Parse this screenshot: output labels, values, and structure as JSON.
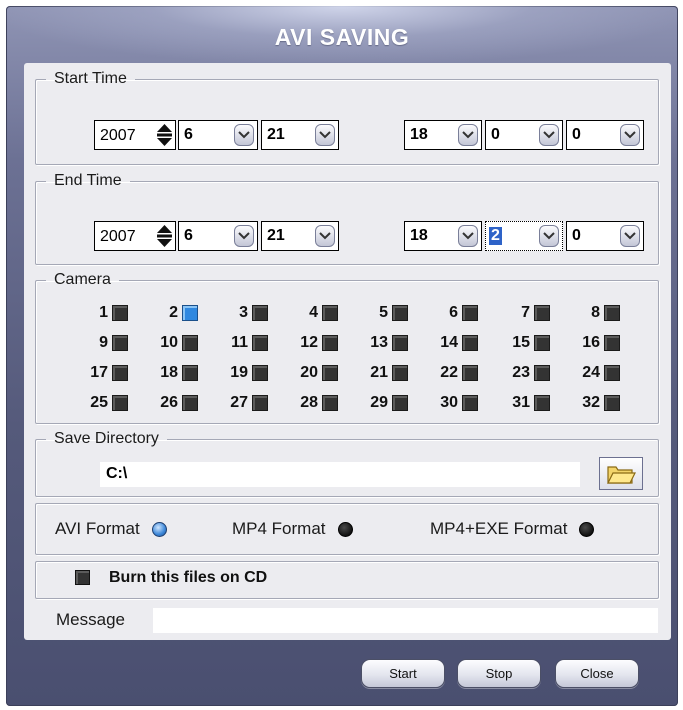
{
  "window": {
    "title": "AVI SAVING"
  },
  "start_time": {
    "legend": "Start Time",
    "year": "2007",
    "month": "6",
    "day": "21",
    "hour": "18",
    "minute": "0",
    "second": "0"
  },
  "end_time": {
    "legend": "End Time",
    "year": "2007",
    "month": "6",
    "day": "21",
    "hour": "18",
    "minute": "2",
    "second": "0"
  },
  "camera": {
    "legend": "Camera",
    "selected": [
      2
    ],
    "labels": [
      "1",
      "2",
      "3",
      "4",
      "5",
      "6",
      "7",
      "8",
      "9",
      "10",
      "11",
      "12",
      "13",
      "14",
      "15",
      "16",
      "17",
      "18",
      "19",
      "20",
      "21",
      "22",
      "23",
      "24",
      "25",
      "26",
      "27",
      "28",
      "29",
      "30",
      "31",
      "32"
    ]
  },
  "save_directory": {
    "legend": "Save Directory",
    "path": "C:\\"
  },
  "format": {
    "options": [
      "AVI Format",
      "MP4 Format",
      "MP4+EXE Format"
    ],
    "selected": "AVI Format"
  },
  "burn": {
    "label": "Burn this files on CD",
    "checked": false
  },
  "message": {
    "label": "Message",
    "value": ""
  },
  "buttons": {
    "start": "Start",
    "stop": "Stop",
    "close": "Close"
  },
  "colors": {
    "window_bg": "#5a5f80",
    "panel_bg": "#ececf0",
    "selected_camera": "#2f88e0",
    "highlight": "#2e63c8"
  }
}
